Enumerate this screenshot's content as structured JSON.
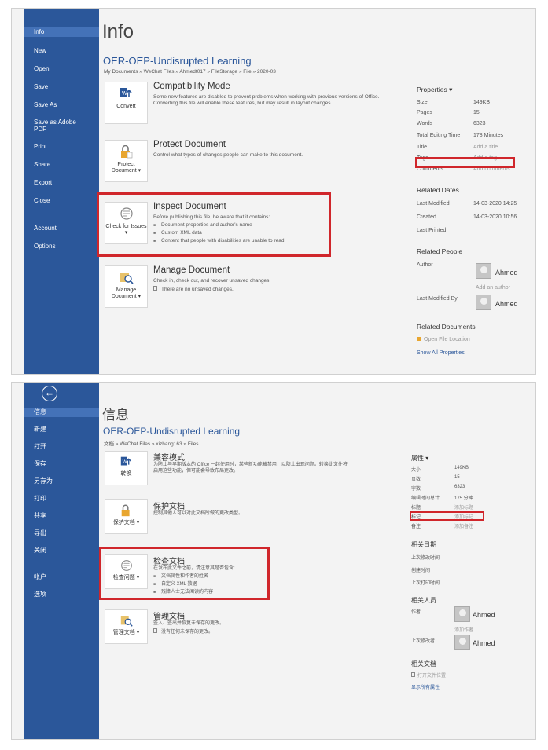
{
  "english": {
    "nav": [
      "Info",
      "New",
      "Open",
      "Save",
      "Save As",
      "Save as Adobe PDF",
      "Print",
      "Share",
      "Export",
      "Close",
      "Account",
      "Options"
    ],
    "title": "Info",
    "doc_name": "OER-OEP-Undisrupted Learning",
    "path": "My Documents » WeChat Files » Ahmedt017 » FileStorage » File » 2020-03",
    "compat": {
      "btn": "Convert",
      "title": "Compatibility Mode",
      "desc": "Some new features are disabled to prevent problems when working with previous versions of Office. Converting this file will enable these features, but may result in layout changes."
    },
    "protect": {
      "btn": "Protect Document ▾",
      "title": "Protect Document",
      "desc": "Control what types of changes people can make to this document."
    },
    "inspect": {
      "btn": "Check for Issues ▾",
      "title": "Inspect Document",
      "desc": "Before publishing this file, be aware that it contains:",
      "items": [
        "Document properties and author's name",
        "Custom XML data",
        "Content that people with disabilities are unable to read"
      ]
    },
    "manage": {
      "btn": "Manage Document ▾",
      "title": "Manage Document",
      "desc": "Check in, check out, and recover unsaved changes.",
      "note": "There are no unsaved changes."
    },
    "props": {
      "header": "Properties ▾",
      "size_k": "Size",
      "size_v": "149KB",
      "pages_k": "Pages",
      "pages_v": "15",
      "words_k": "Words",
      "words_v": "6323",
      "edit_k": "Total Editing Time",
      "edit_v": "178 Minutes",
      "title_k": "Title",
      "title_v": "Add a title",
      "tags_k": "Tags",
      "tags_v": "Add a tag",
      "comments_k": "Comments",
      "comments_v": "Add comments"
    },
    "dates": {
      "header": "Related Dates",
      "modified_k": "Last Modified",
      "modified_v": "14-03-2020 14:25",
      "created_k": "Created",
      "created_v": "14-03-2020 10:56",
      "printed_k": "Last Printed"
    },
    "people": {
      "header": "Related People",
      "author_k": "Author",
      "author_v": "Ahmed",
      "add_author": "Add an author",
      "lastmod_k": "Last Modified By",
      "lastmod_v": "Ahmed"
    },
    "docs": {
      "header": "Related Documents",
      "open": "Open File Location",
      "show_all": "Show All Properties"
    }
  },
  "chinese": {
    "nav": [
      "信息",
      "新建",
      "打开",
      "保存",
      "另存为",
      "打印",
      "共享",
      "导出",
      "关闭",
      "帐户",
      "选项"
    ],
    "title": "信息",
    "doc_name": "OER-OEP-Undisrupted Learning",
    "path": "文档 » WeChat Files » xizhang163 » Files",
    "compat": {
      "btn": "转换",
      "title": "兼容模式",
      "desc": "为防止与早期版本的 Office 一起使用时，某些新功能被禁用，以防止出现问题。转换此文件将启用这些功能，但可能会导致布局更改。"
    },
    "protect": {
      "btn": "保护文档 ▾",
      "title": "保护文档",
      "desc": "控制其他人可以对此文档所做的更改类型。"
    },
    "inspect": {
      "btn": "检查问题 ▾",
      "title": "检查文档",
      "desc": "在发布此文件之前，请注意其是否包含:",
      "items": [
        "文档属性和作者的姓名",
        "自定义 XML 数据",
        "残障人士无法阅读的内容"
      ]
    },
    "manage": {
      "btn": "管理文档 ▾",
      "title": "管理文档",
      "desc": "签入、签出并恢复未保存的更改。",
      "note": "没有任何未保存的更改。"
    },
    "props": {
      "header": "属性 ▾",
      "size_k": "大小",
      "size_v": "149KB",
      "pages_k": "页数",
      "pages_v": "15",
      "words_k": "字数",
      "words_v": "6323",
      "edit_k": "编辑时间总计",
      "edit_v": "175 分钟",
      "title_k": "标题",
      "title_v": "添加标题",
      "tags_k": "标记",
      "tags_v": "添加标记",
      "comments_k": "备注",
      "comments_v": "添加备注"
    },
    "dates": {
      "header": "相关日期",
      "modified_k": "上次修改时间",
      "created_k": "创建时间",
      "printed_k": "上次打印时间"
    },
    "people": {
      "header": "相关人员",
      "author_k": "作者",
      "author_v": "Ahmed",
      "add_author": "添加作者",
      "lastmod_k": "上次修改者",
      "lastmod_v": "Ahmed"
    },
    "docs": {
      "header": "相关文档",
      "open": "打开文件位置",
      "show_all": "显示所有属性"
    }
  },
  "colors": {
    "sidebar": "#2b579a",
    "accent": "#2b579a",
    "highlight": "#d0262b"
  }
}
